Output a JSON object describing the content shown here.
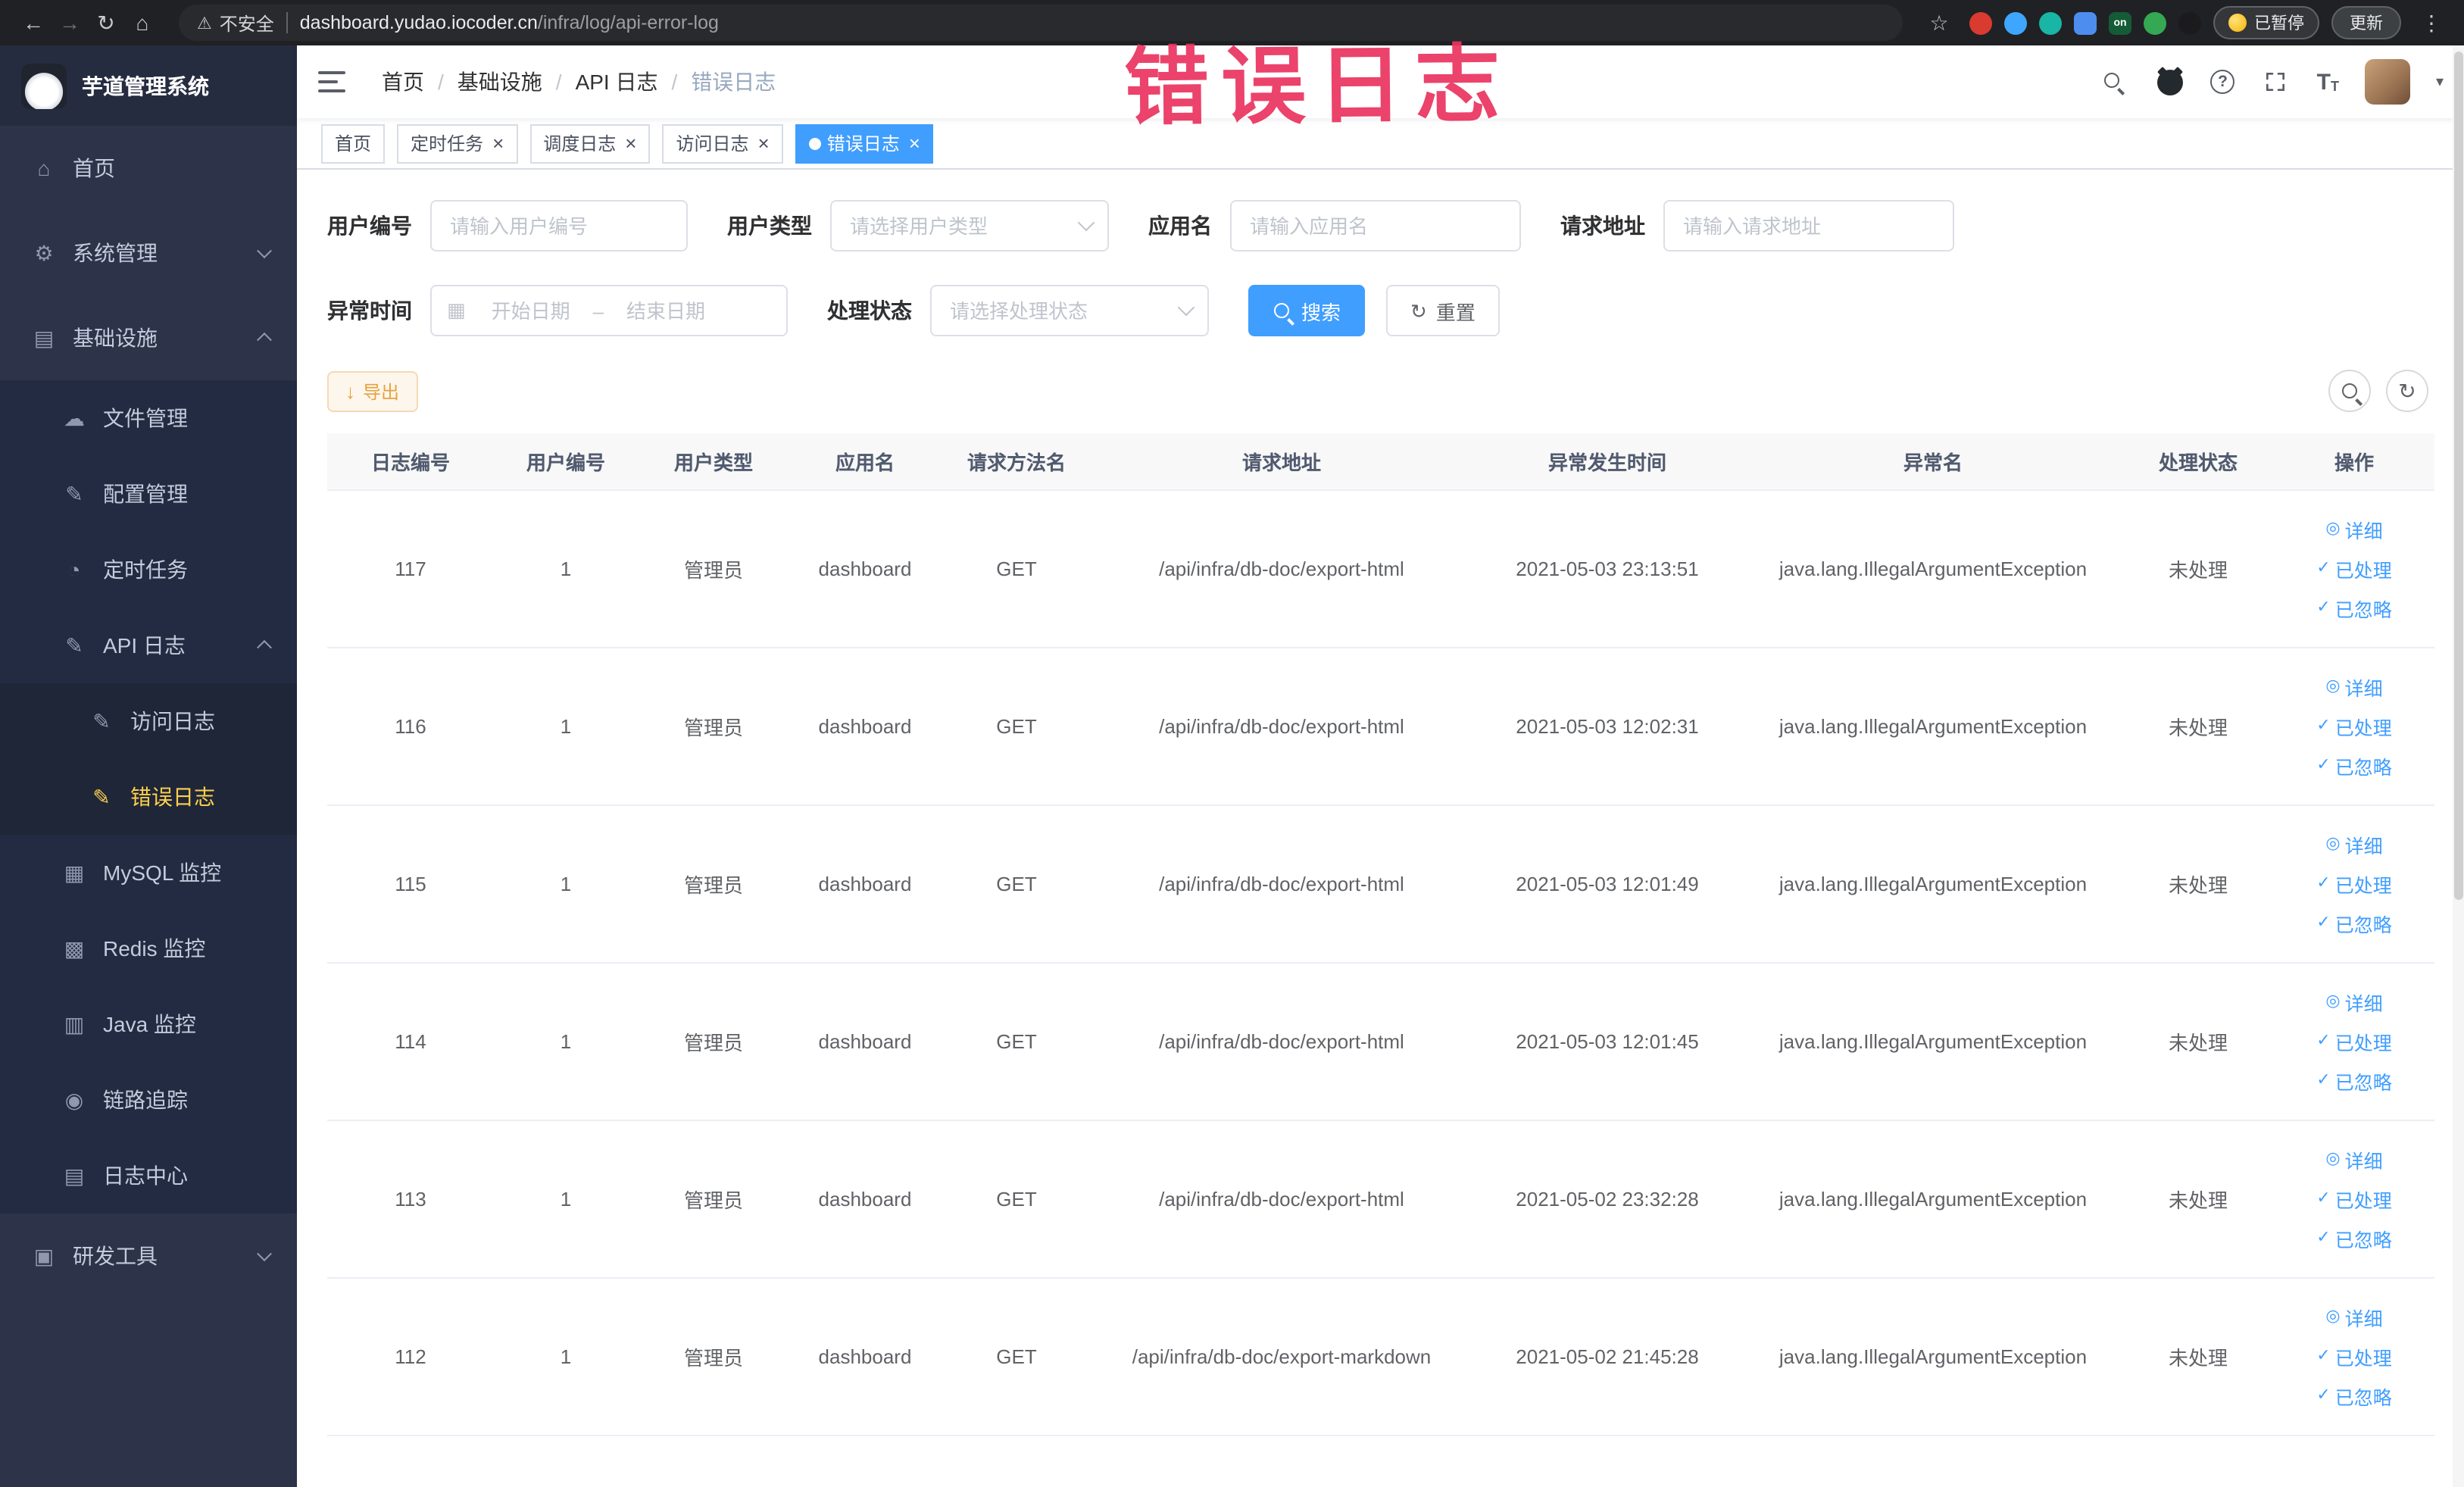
{
  "browser": {
    "security_label": "不安全",
    "url_host": "dashboard.yudao.iocoder.cn",
    "url_path": "/infra/log/api-error-log",
    "extension_on_label": "on",
    "paused_badge": "已暂停",
    "update_button": "更新"
  },
  "icons": {
    "back": "←",
    "forward": "→",
    "reload": "↻",
    "home": "⌂",
    "warning": "⚠",
    "star": "☆",
    "menu_dots": "⋮",
    "caret_down": "▾",
    "close": "×",
    "calendar": "▦",
    "range_separator": "–",
    "download": "↓",
    "refresh": "↻",
    "question": "?",
    "font_size": "T",
    "sidebar_home": "⌂",
    "sidebar_system": "⚙",
    "sidebar_infra": "▤",
    "sidebar_file": "☁",
    "sidebar_config": "✎",
    "sidebar_job": "◔",
    "sidebar_api_log": "✎",
    "sidebar_access_log": "✎",
    "sidebar_error_log": "✎",
    "sidebar_mysql": "▦",
    "sidebar_redis": "▩",
    "sidebar_java": "▥",
    "sidebar_trace": "◉",
    "sidebar_log_center": "▤",
    "sidebar_devtools": "▣"
  },
  "sidebar": {
    "app_title": "芋道管理系统",
    "items": [
      {
        "label": "首页"
      },
      {
        "label": "系统管理"
      },
      {
        "label": "基础设施",
        "children": [
          {
            "label": "文件管理"
          },
          {
            "label": "配置管理"
          },
          {
            "label": "定时任务"
          },
          {
            "label": "API 日志",
            "children": [
              {
                "label": "访问日志"
              },
              {
                "label": "错误日志"
              }
            ]
          },
          {
            "label": "MySQL 监控"
          },
          {
            "label": "Redis 监控"
          },
          {
            "label": "Java 监控"
          },
          {
            "label": "链路追踪"
          },
          {
            "label": "日志中心"
          }
        ]
      },
      {
        "label": "研发工具"
      }
    ]
  },
  "header": {
    "breadcrumb": [
      "首页",
      "基础设施",
      "API 日志",
      "错误日志"
    ],
    "separator": "/"
  },
  "tabs": [
    {
      "label": "首页"
    },
    {
      "label": "定时任务"
    },
    {
      "label": "调度日志"
    },
    {
      "label": "访问日志"
    },
    {
      "label": "错误日志"
    }
  ],
  "annotation": "错误日志",
  "filters": {
    "user_id_label": "用户编号",
    "user_id_placeholder": "请输入用户编号",
    "user_type_label": "用户类型",
    "user_type_placeholder": "请选择用户类型",
    "app_name_label": "应用名",
    "app_name_placeholder": "请输入应用名",
    "request_url_label": "请求地址",
    "request_url_placeholder": "请输入请求地址",
    "exception_time_label": "异常时间",
    "start_date_placeholder": "开始日期",
    "end_date_placeholder": "结束日期",
    "process_status_label": "处理状态",
    "process_status_placeholder": "请选择处理状态",
    "search_label": "搜索",
    "reset_label": "重置"
  },
  "toolbar": {
    "export_label": "导出"
  },
  "table": {
    "columns": [
      "日志编号",
      "用户编号",
      "用户类型",
      "应用名",
      "请求方法名",
      "请求地址",
      "异常发生时间",
      "异常名",
      "处理状态",
      "操作"
    ],
    "row_fields": [
      "id",
      "user_id",
      "user_type",
      "app",
      "method",
      "url",
      "time",
      "exception",
      "status"
    ],
    "actions": [
      {
        "name": "detail",
        "label": "详细",
        "icon": "◎"
      },
      {
        "name": "processed",
        "label": "已处理",
        "icon": "✓"
      },
      {
        "name": "ignored",
        "label": "已忽略",
        "icon": "✓"
      }
    ],
    "rows": [
      {
        "id": "117",
        "user_id": "1",
        "user_type": "管理员",
        "app": "dashboard",
        "method": "GET",
        "url": "/api/infra/db-doc/export-html",
        "time": "2021-05-03 23:13:51",
        "exception": "java.lang.IllegalArgumentException",
        "status": "未处理"
      },
      {
        "id": "116",
        "user_id": "1",
        "user_type": "管理员",
        "app": "dashboard",
        "method": "GET",
        "url": "/api/infra/db-doc/export-html",
        "time": "2021-05-03 12:02:31",
        "exception": "java.lang.IllegalArgumentException",
        "status": "未处理"
      },
      {
        "id": "115",
        "user_id": "1",
        "user_type": "管理员",
        "app": "dashboard",
        "method": "GET",
        "url": "/api/infra/db-doc/export-html",
        "time": "2021-05-03 12:01:49",
        "exception": "java.lang.IllegalArgumentException",
        "status": "未处理"
      },
      {
        "id": "114",
        "user_id": "1",
        "user_type": "管理员",
        "app": "dashboard",
        "method": "GET",
        "url": "/api/infra/db-doc/export-html",
        "time": "2021-05-03 12:01:45",
        "exception": "java.lang.IllegalArgumentException",
        "status": "未处理"
      },
      {
        "id": "113",
        "user_id": "1",
        "user_type": "管理员",
        "app": "dashboard",
        "method": "GET",
        "url": "/api/infra/db-doc/export-html",
        "time": "2021-05-02 23:32:28",
        "exception": "java.lang.IllegalArgumentException",
        "status": "未处理"
      },
      {
        "id": "112",
        "user_id": "1",
        "user_type": "管理员",
        "app": "dashboard",
        "method": "GET",
        "url": "/api/infra/db-doc/export-markdown",
        "time": "2021-05-02 21:45:28",
        "exception": "java.lang.IllegalArgumentException",
        "status": "未处理"
      }
    ]
  },
  "colors": {
    "accent": "#409eff",
    "active_menu_text": "#ffd04b",
    "export_text": "#e6a23c",
    "annotation": "#ea3560"
  }
}
